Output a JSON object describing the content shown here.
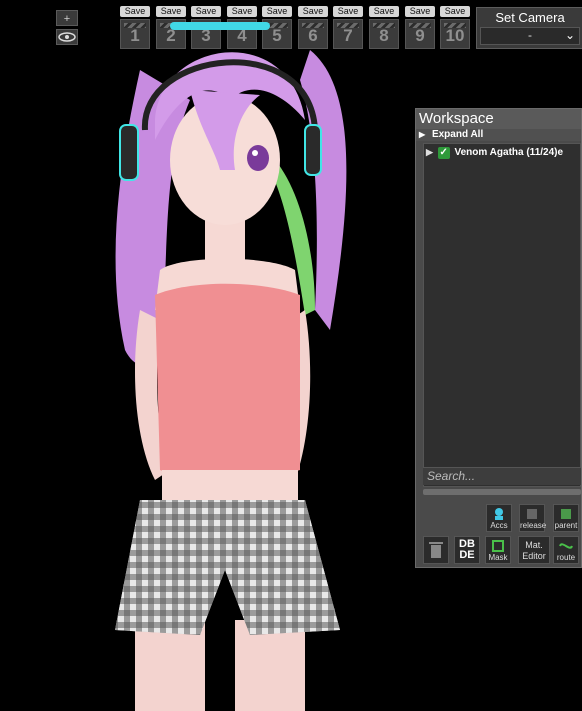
{
  "top_controls": {
    "plus": "+",
    "eye": "👁"
  },
  "save_slots": [
    {
      "save": "Save",
      "num": "1"
    },
    {
      "save": "Save",
      "num": "2"
    },
    {
      "save": "Save",
      "num": "3"
    },
    {
      "save": "Save",
      "num": "4"
    },
    {
      "save": "Save",
      "num": "5"
    },
    {
      "save": "Save",
      "num": "6"
    },
    {
      "save": "Save",
      "num": "7"
    },
    {
      "save": "Save",
      "num": "8"
    },
    {
      "save": "Save",
      "num": "9"
    },
    {
      "save": "Save",
      "num": "10"
    }
  ],
  "camera": {
    "title": "Set Camera",
    "selected": "-"
  },
  "workspace": {
    "title": "Workspace",
    "expand_all": "Expand All",
    "node": "Venom Agatha (11/24)e",
    "search_placeholder": "Search...",
    "tools": {
      "accs": "Accs",
      "release": "release",
      "parent": "parent",
      "dbde": "DB DE",
      "mask": "Mask",
      "mat": "Mat. Editor",
      "route": "route"
    }
  }
}
